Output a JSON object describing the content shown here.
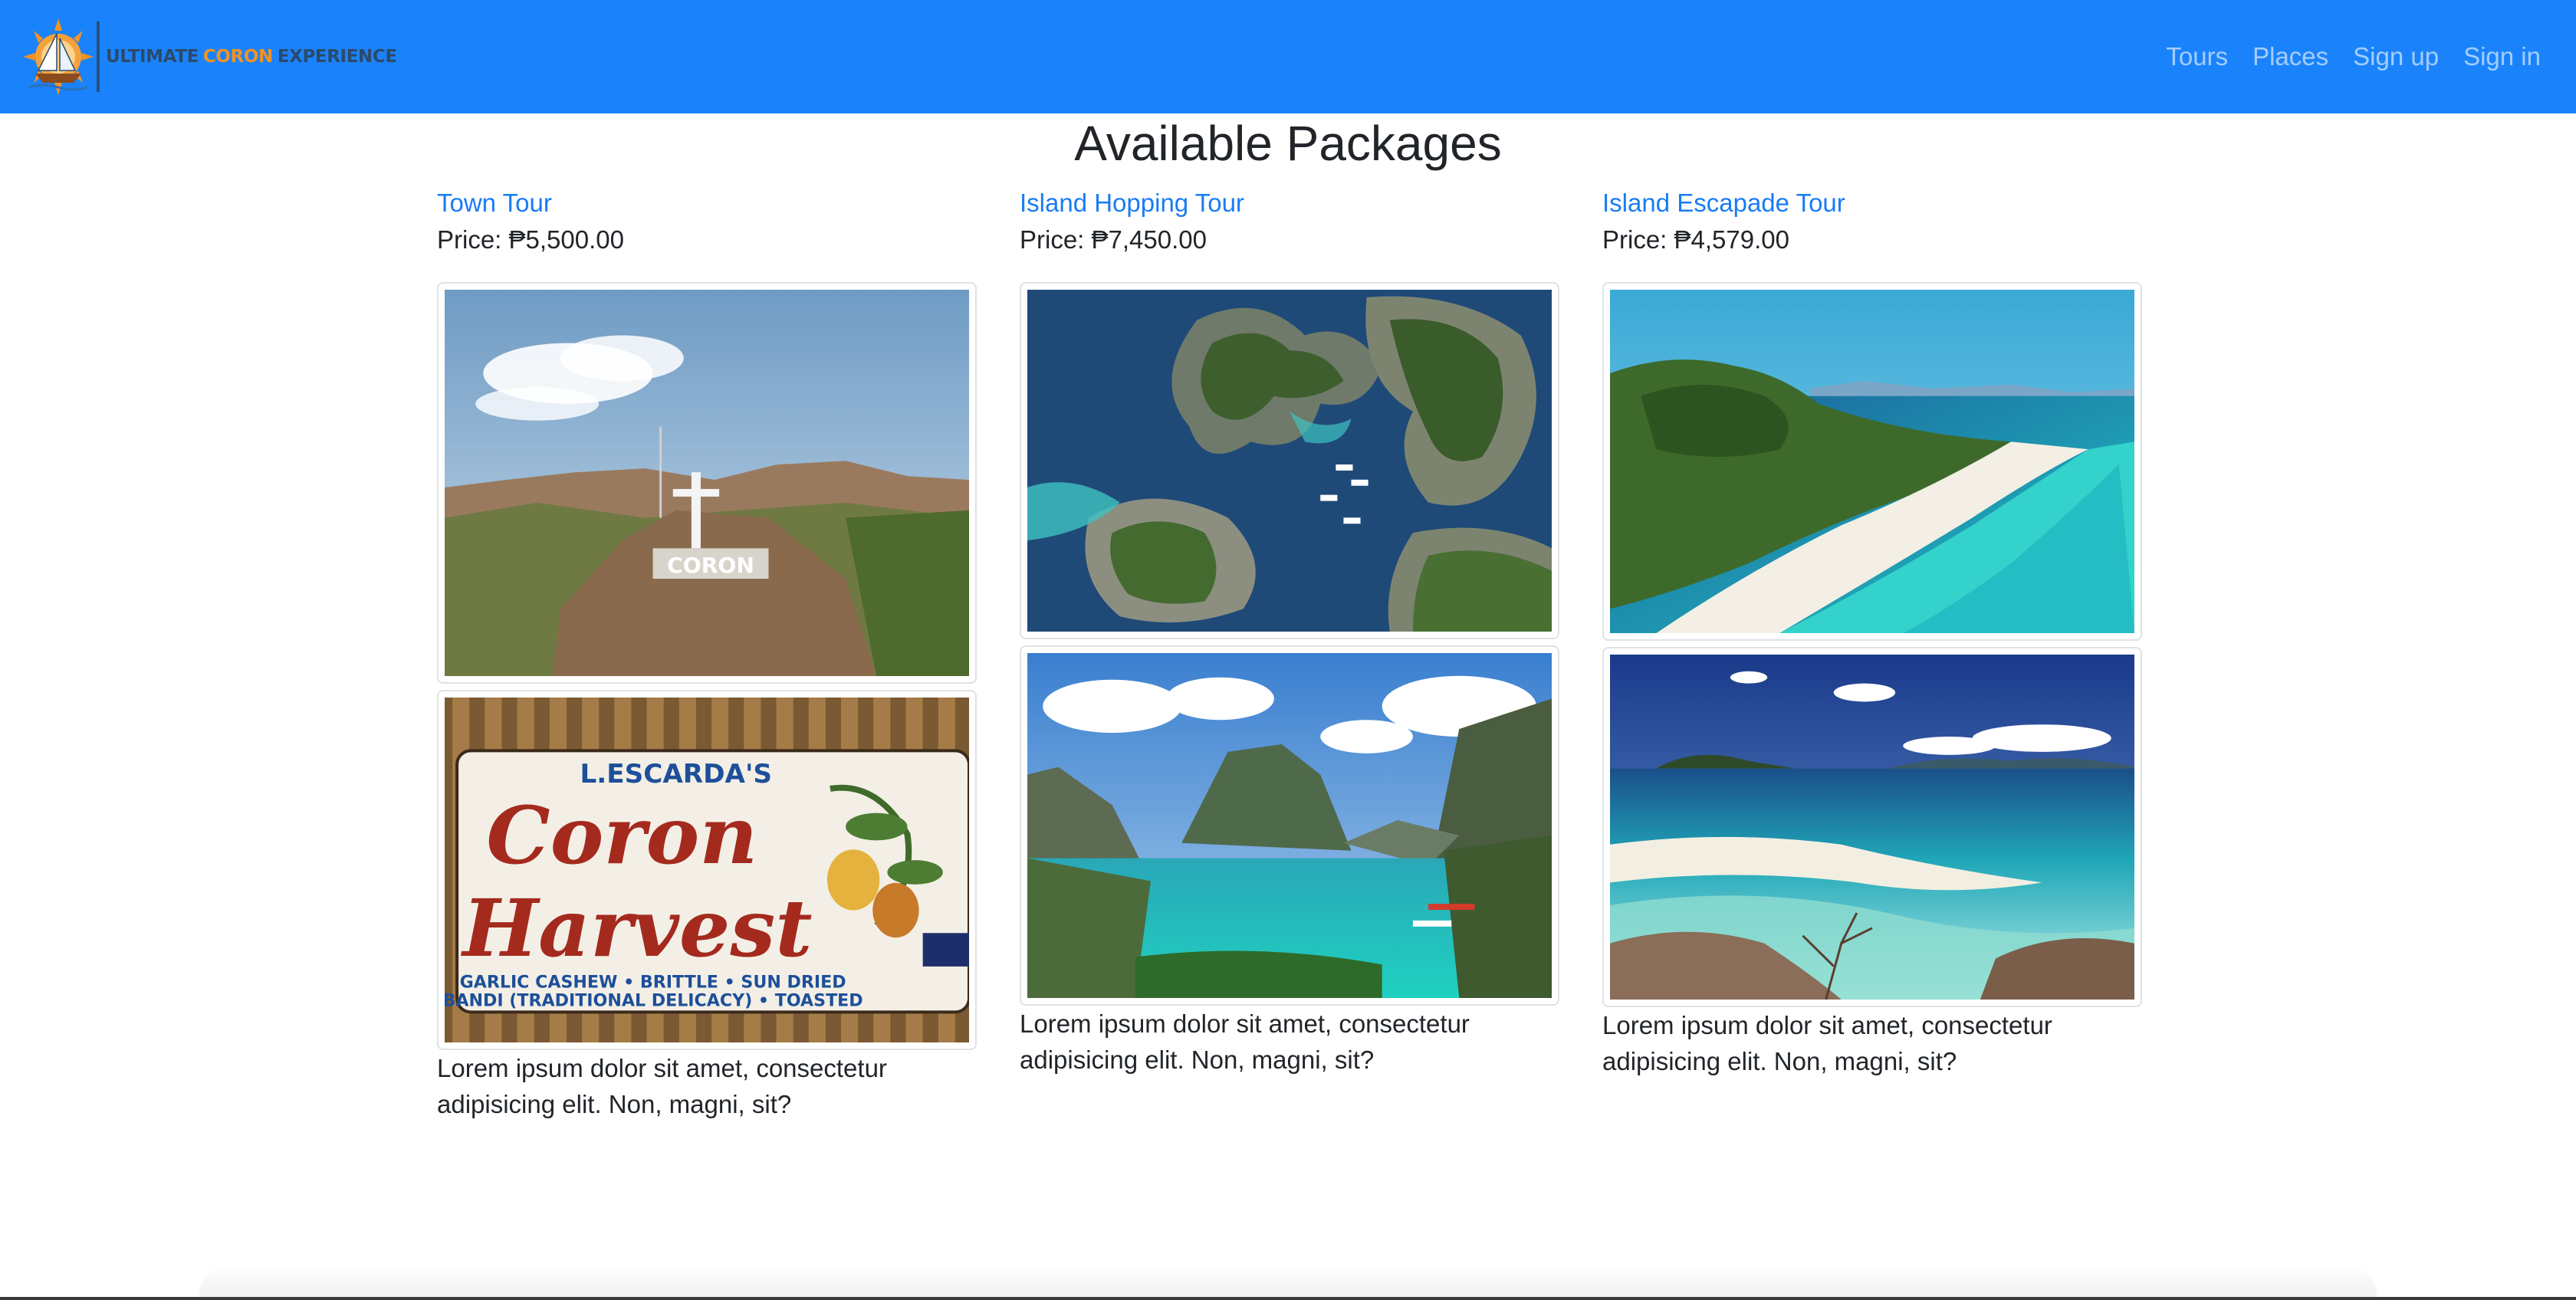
{
  "brand": {
    "text_part1": "ULTIMATE",
    "text_part2": "CORON",
    "text_part3": "EXPERIENCE",
    "logo_icon": "sailboat-sun-logo"
  },
  "nav": {
    "items": [
      "Tours",
      "Places",
      "Sign up",
      "Sign in"
    ]
  },
  "page": {
    "title": "Available Packages"
  },
  "packages": [
    {
      "name": "Town Tour",
      "price": "Price: ₱5,500.00",
      "images": [
        "coron-hill-sign-photo",
        "coron-harvest-sign-photo"
      ],
      "description": "Lorem ipsum dolor sit amet, consectetur adipisicing elit. Non, magni, sit?"
    },
    {
      "name": "Island Hopping Tour",
      "price": "Price: ₱7,450.00",
      "images": [
        "aerial-lagoon-islands-photo",
        "kayangan-lake-photo"
      ],
      "description": "Lorem ipsum dolor sit amet, consectetur adipisicing elit. Non, magni, sit?"
    },
    {
      "name": "Island Escapade Tour",
      "price": "Price: ₱4,579.00",
      "images": [
        "white-sand-beach-aerial-photo",
        "sandbar-shallow-sea-photo"
      ],
      "description": "Lorem ipsum dolor sit amet, consectetur adipisicing elit. Non, magni, sit?"
    }
  ],
  "colors": {
    "navbar_bg": "#1a83fb",
    "link": "#1a7cf3",
    "brand_accent": "#f29224"
  }
}
